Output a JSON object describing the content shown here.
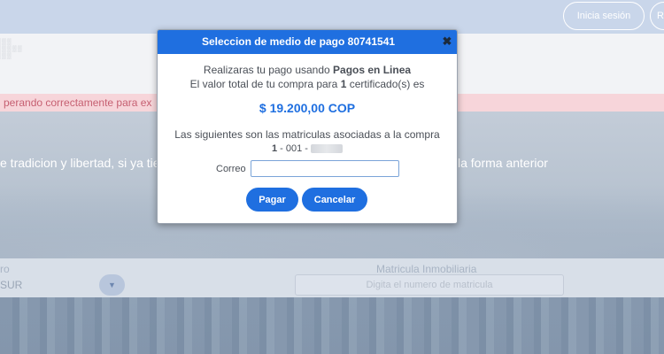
{
  "header": {
    "login_button": "Inicia sesión",
    "other_button": "R"
  },
  "alert": {
    "text": "perando correctamente para ex"
  },
  "hero": {
    "headline_left": "e tradicion y libertad, si ya tie",
    "headline_right": "la forma anterior"
  },
  "search_form": {
    "left_label": "ro",
    "left_select_value": "SUR",
    "matricula_label": "Matricula Inmobiliaria",
    "matricula_placeholder": "Digita el numero de matricula"
  },
  "modal": {
    "title": "Seleccion de medio de pago 80741541",
    "close_symbol": "✖",
    "line1_prefix": "Realizaras tu pago usando ",
    "line1_method": "Pagos en Linea",
    "line2_prefix": "El valor total de tu compra para ",
    "line2_count": "1",
    "line2_suffix": " certificado(s) es",
    "price": "$ 19.200,00 COP",
    "matriculas_text": "Las siguientes son las matriculas asociadas a la compra",
    "matricula_prefix_bold": "1",
    "matricula_rest": " - 001 - ",
    "email_label": "Correo",
    "email_value": "",
    "pay_button": "Pagar",
    "cancel_button": "Cancelar"
  },
  "colors": {
    "primary": "#1f6fe0",
    "alert_bg": "#f7d5da",
    "alert_text": "#c66072"
  }
}
